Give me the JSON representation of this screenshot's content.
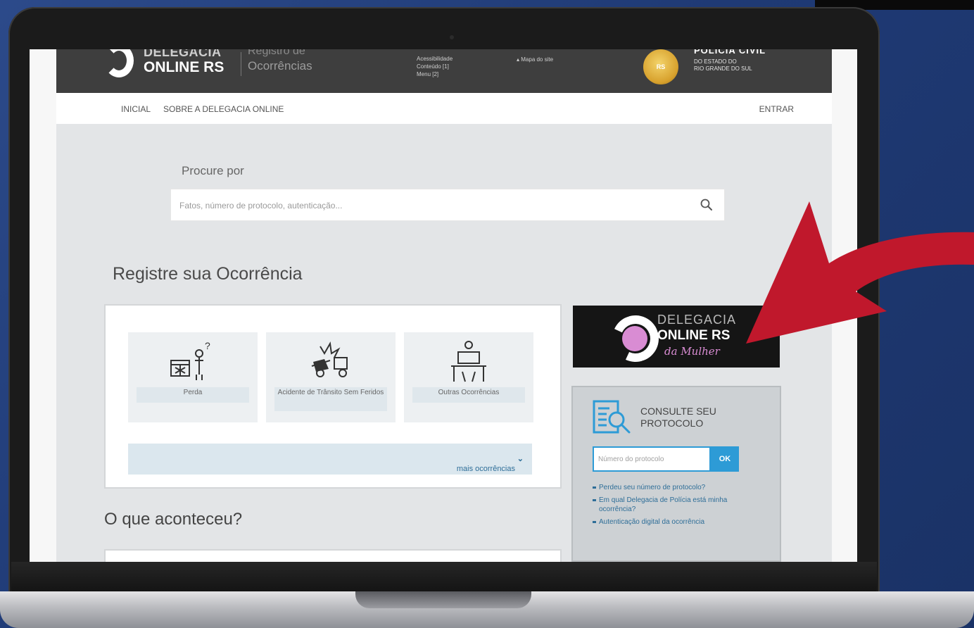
{
  "header": {
    "logo_line1": "DELEGACIA",
    "logo_line2": "ONLINE RS",
    "logo_sub1": "Registro de",
    "logo_sub2": "Ocorrências",
    "access_links": [
      "Acessibilidade",
      "Conteúdo [1]",
      "Menu [2]"
    ],
    "sitemap": "Mapa do site",
    "badge_text": "RS",
    "police_title": "POLÍCIA CIVIL",
    "police_sub1": "DO ESTADO DO",
    "police_sub2": "RIO GRANDE DO SUL"
  },
  "nav": {
    "home": "INICIAL",
    "about": "SOBRE A DELEGACIA ONLINE",
    "login": "ENTRAR"
  },
  "search": {
    "label": "Procure por",
    "placeholder": "Fatos, número de protocolo, autenticação..."
  },
  "register": {
    "heading": "Registre sua Ocorrência",
    "tiles": [
      {
        "label": "Perda",
        "icon": "lost-items-icon"
      },
      {
        "label": "Acidente de Trânsito Sem Feridos",
        "icon": "traffic-accident-icon"
      },
      {
        "label": "Outras Ocorrências",
        "icon": "other-occurrences-icon"
      }
    ],
    "more": "mais ocorrências"
  },
  "happened": {
    "heading": "O que aconteceu?"
  },
  "women_banner": {
    "line1": "DELEGACIA",
    "line2": "ONLINE RS",
    "line3": "da Mulher"
  },
  "protocol": {
    "title_line1": "CONSULTE SEU",
    "title_line2": "PROTOCOLO",
    "placeholder": "Número do protocolo",
    "ok": "OK",
    "links": [
      "Perdeu seu número de protocolo?",
      "Em qual Delegacia de Polícia está minha ocorrência?",
      "Autenticação digital da ocorrência"
    ]
  },
  "colors": {
    "background": "#223d7a",
    "accent_red": "#c0182c",
    "accent_blue": "#2d9bd6",
    "women_pink": "#d98cd3"
  }
}
